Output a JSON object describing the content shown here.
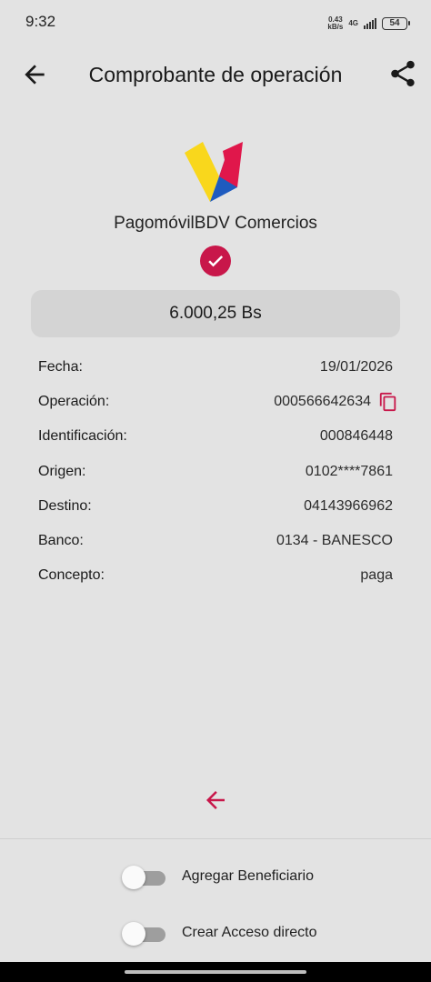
{
  "status_bar": {
    "time": "9:32",
    "speed_value": "0.43",
    "speed_unit": "kB/s",
    "network": "4G",
    "battery": "54"
  },
  "header": {
    "title": "Comprobante de operación",
    "back_icon": "arrow-left-icon",
    "share_icon": "share-icon"
  },
  "brand": {
    "name": "PagomóvilBDV Comercios",
    "logo_colors": [
      "#f9d71c",
      "#1e5bbf",
      "#e0174b"
    ],
    "success_color": "#c8174a"
  },
  "amount": "6.000,25 Bs",
  "details": [
    {
      "label": "Fecha:",
      "value": "19/01/2026"
    },
    {
      "label": "Operación:",
      "value": "000566642634"
    },
    {
      "label": "Identificación:",
      "value": "000846448"
    },
    {
      "label": "Origen:",
      "value": "0102****7861"
    },
    {
      "label": "Destino:",
      "value": "04143966962"
    },
    {
      "label": "Banco:",
      "value": "0134 - BANESCO"
    },
    {
      "label": "Concepto:",
      "value": "paga"
    }
  ],
  "accent_color": "#c8174a",
  "options": {
    "add_beneficiary": {
      "label": "Agregar Beneficiario",
      "enabled": false
    },
    "shortcut": {
      "label": "Crear Acceso directo",
      "enabled": false
    }
  }
}
